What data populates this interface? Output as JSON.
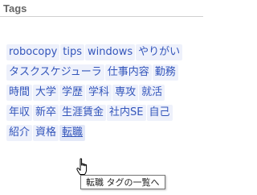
{
  "widget": {
    "title": "Tags"
  },
  "tags": {
    "rows": [
      [
        "robocopy",
        "tips",
        "windows",
        "やりがい"
      ],
      [
        "タスクスケジューラ",
        "仕事内容",
        "勤務"
      ],
      [
        "時間",
        "大学",
        "学歴",
        "学科",
        "専攻",
        "就活"
      ],
      [
        "年収",
        "新卒",
        "生涯賃金",
        "社内SE",
        "自己"
      ],
      [
        "紹介",
        "資格",
        "転職"
      ]
    ],
    "hovered": "転職"
  },
  "tooltip": {
    "text": "転職 タグの一覧へ"
  },
  "colors": {
    "tag_background": "#eef1fb",
    "tag_text": "#3355bb",
    "title_text": "#666666"
  },
  "icons": {
    "cursor": "hand-pointer-icon"
  }
}
